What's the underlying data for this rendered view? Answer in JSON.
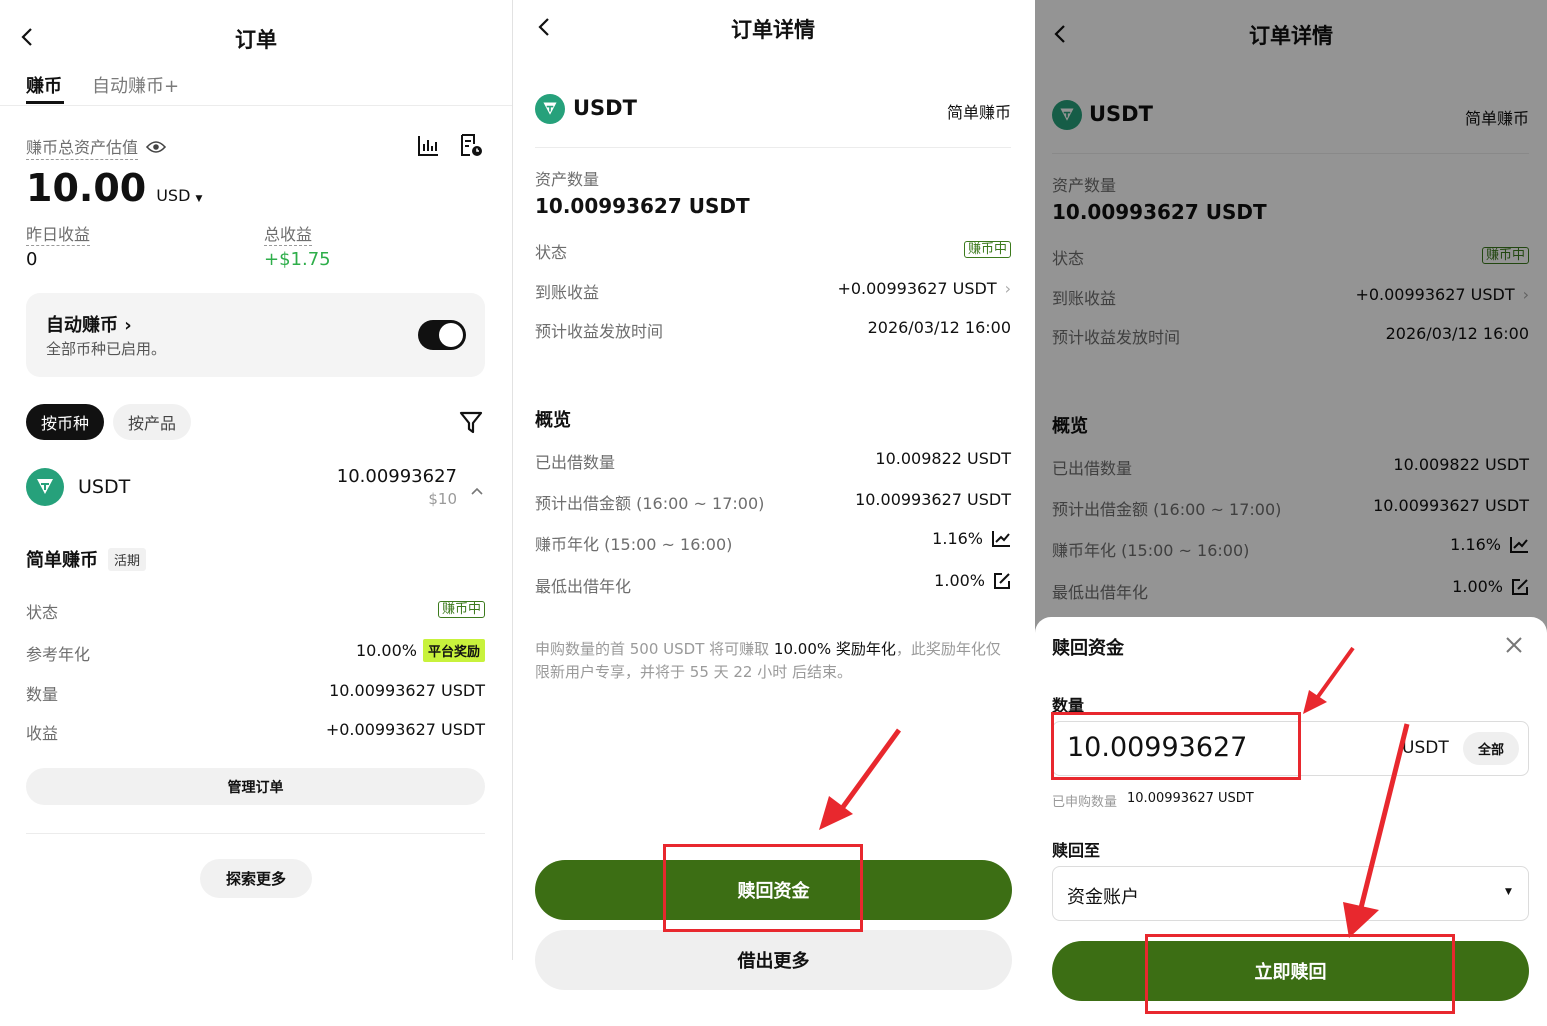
{
  "colors": {
    "accent": "#3c6e14",
    "positive": "#2eae4a",
    "badge_yellow": "#c8f23c",
    "annotation_red": "#e8282e",
    "usdt_green": "#26a17b"
  },
  "s1": {
    "title": "订单",
    "tabs": [
      "赚币",
      "自动赚币+"
    ],
    "asset_label": "赚币总资产估值",
    "asset_value": "10.00",
    "asset_currency": "USD",
    "yesterday_label": "昨日收益",
    "yesterday_value": "0",
    "total_label": "总收益",
    "total_value": "+$1.75",
    "auto_title": "自动赚币",
    "auto_sub": "全部币种已启用。",
    "filter_by_coin": "按币种",
    "filter_by_product": "按产品",
    "coin_name": "USDT",
    "coin_amount": "10.00993627",
    "coin_usd": "$10",
    "product_title": "简单赚币",
    "product_tag": "活期",
    "rows": [
      {
        "label": "状态",
        "value": "赚币中"
      },
      {
        "label": "参考年化",
        "value": "10.00%",
        "extra": "平台奖励"
      },
      {
        "label": "数量",
        "value": "10.00993627 USDT"
      },
      {
        "label": "收益",
        "value": "+0.00993627 USDT"
      }
    ],
    "manage_btn": "管理订单",
    "explore_btn": "探索更多"
  },
  "detail": {
    "title": "订单详情",
    "coin": "USDT",
    "product": "简单赚币",
    "amount_label": "资产数量",
    "amount_value": "10.00993627 USDT",
    "status_label": "状态",
    "status_value": "赚币中",
    "earn_label": "到账收益",
    "earn_value": "+0.00993627 USDT",
    "time_label": "预计收益发放时间",
    "time_value": "2026/03/12 16:00",
    "overview_title": "概览",
    "lent_label": "已出借数量",
    "lent_value": "10.009822 USDT",
    "expected_label": "预计出借金额 (16:00 ~ 17:00)",
    "expected_value": "10.00993627 USDT",
    "apr_label": "赚币年化 (15:00 ~ 16:00)",
    "apr_value": "1.16%",
    "min_label": "最低出借年化",
    "min_value": "1.00%",
    "note_pre": "申购数量的首 500 USDT 将可赚取 ",
    "note_bold": "10.00% 奖励年化",
    "note_post": "，此奖励年化仅限新用户专享，并将于 55 天 22 小时 后结束。",
    "redeem_btn": "赎回资金",
    "lend_more_btn": "借出更多"
  },
  "sheet": {
    "title": "赎回资金",
    "qty_label": "数量",
    "qty_value": "10.00993627",
    "qty_unit": "USDT",
    "all_btn": "全部",
    "subscribed_label": "已申购数量",
    "subscribed_value": "10.00993627 USDT",
    "to_label": "赎回至",
    "to_value": "资金账户",
    "confirm_btn": "立即赎回"
  }
}
